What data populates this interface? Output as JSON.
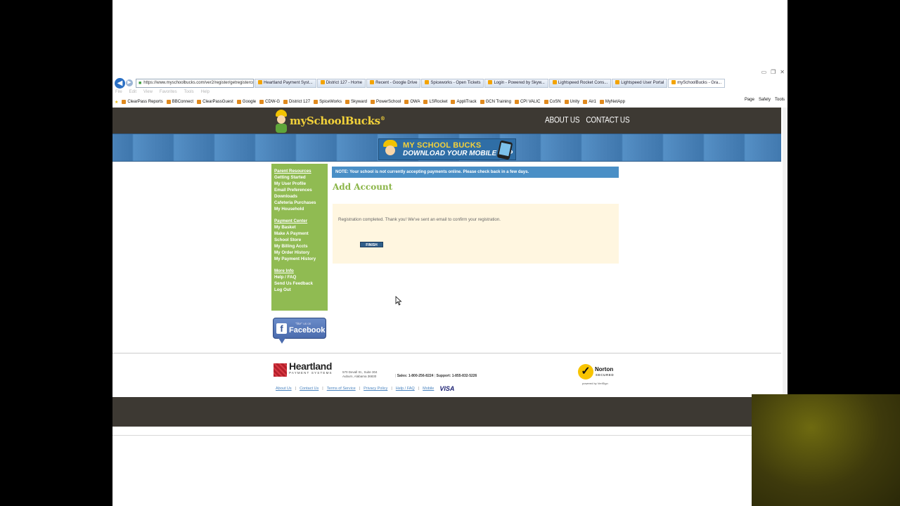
{
  "browser": {
    "address": "https://www.myschoolbucks.com/ver2/register/getregistercom",
    "address_domain_prefix": "https://www.",
    "tabs": [
      {
        "label": "Heartland Payment Syst...",
        "active": false
      },
      {
        "label": "District 127 - Home",
        "active": false
      },
      {
        "label": "Recent - Google Drive",
        "active": false
      },
      {
        "label": "Spiceworks - Open Tickets",
        "active": false
      },
      {
        "label": "Login - Powered by Skyw...",
        "active": false
      },
      {
        "label": "Lightspeed Rocket Cons...",
        "active": false
      },
      {
        "label": "Lightspeed User Portal",
        "active": false
      },
      {
        "label": "mySchoolBucks - Gra...",
        "active": true
      }
    ],
    "menu": [
      "File",
      "Edit",
      "View",
      "Favorites",
      "Tools",
      "Help"
    ],
    "favorites": [
      "ClearPass Reports",
      "BBConnect",
      "ClearPassGuest",
      "Google",
      "CDW-G",
      "District 127",
      "SpiceWorks",
      "Skyward",
      "PowerSchool",
      "OWA",
      "LSRocket",
      "AppliTrack",
      "GCN Training",
      "CPI VALIC",
      "CoSN",
      "Unity",
      "Air1",
      "MyNetApp"
    ],
    "command_bar": [
      "Page",
      "Safety",
      "Tools"
    ]
  },
  "site": {
    "logo_text": "mySchoolBucks",
    "logo_mark": "®",
    "nav": [
      "ABOUT US",
      "CONTACT US"
    ],
    "banner_line1": "MY SCHOOL BUCKS",
    "banner_line2": "DOWNLOAD YOUR MOBILE APP"
  },
  "sidebar": {
    "sections": [
      {
        "head": "Parent Resources",
        "items": [
          "Getting Started",
          "My User Profile",
          "Email Preferences",
          "Downloads",
          "Cafeteria Purchases",
          "My Household"
        ]
      },
      {
        "head": "Payment Center",
        "items": [
          "My Basket",
          "Make A Payment",
          "School Store",
          "My Billing Accts",
          "My Order History",
          "My Payment History"
        ]
      },
      {
        "head": "More Info",
        "items": [
          "Help / FAQ",
          "Send Us Feedback",
          "Log Out"
        ]
      }
    ],
    "facebook_like": "\"like\" us on",
    "facebook_name": "Facebook"
  },
  "main": {
    "note": "NOTE: Your school is not currently accepting payments online. Please check back in a few days.",
    "title": "Add Account",
    "message": "Registration completed. Thank you! We've sent an email to confirm your registration.",
    "finish_label": "FINISH"
  },
  "footer": {
    "company": "Heartland",
    "company_sub": "PAYMENT SYSTEMS",
    "address_line1": "570 Devall St., Suite 304",
    "address_line2": "Auburn, Alabama 36830",
    "sales": "Sales: 1-800-256-8224",
    "support": "Support: 1-855-832-5226",
    "links": [
      "About Us",
      "Contact Us",
      "Terms of Service",
      "Privacy Policy",
      "Help / FAQ",
      "Mobile"
    ],
    "visa": "VISA",
    "norton_title": "Norton",
    "norton_sub": "SECURED",
    "norton_by": "powered by VeriSign"
  }
}
